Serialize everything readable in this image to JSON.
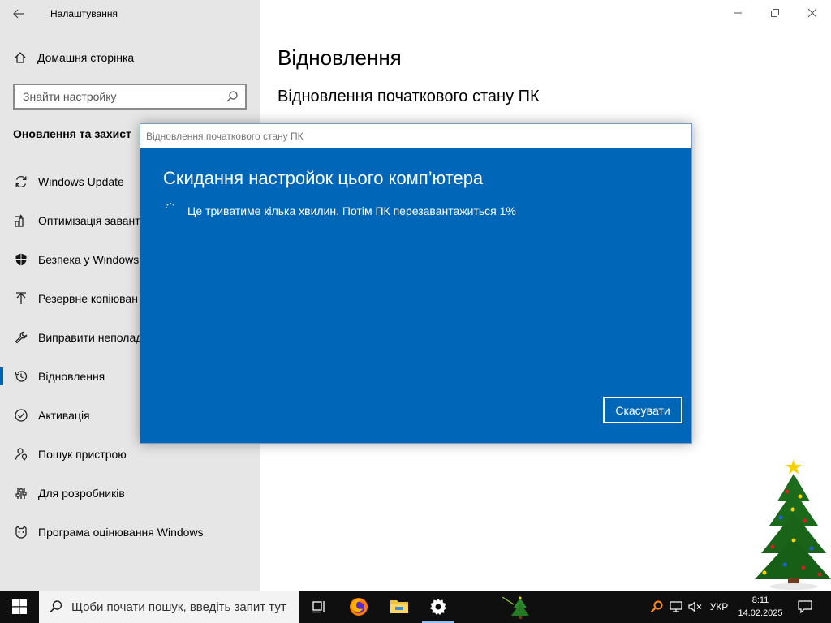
{
  "window": {
    "title": "Налаштування",
    "back_icon": "back-arrow-icon",
    "minimize_icon": "minimize-icon",
    "maximize_icon": "restore-icon",
    "close_icon": "close-icon"
  },
  "sidebar": {
    "home_label": "Домашня сторінка",
    "search_placeholder": "Знайти настройку",
    "section_title": "Оновлення та захист",
    "items": [
      {
        "label": "Windows Update",
        "icon": "sync-icon"
      },
      {
        "label": "Оптимізація завант",
        "icon": "delivery-optimization-icon"
      },
      {
        "label": "Безпека у Windows",
        "icon": "shield-icon"
      },
      {
        "label": "Резервне копіюван",
        "icon": "backup-arrow-icon"
      },
      {
        "label": "Виправити неполад",
        "icon": "wrench-icon"
      },
      {
        "label": "Відновлення",
        "icon": "history-icon",
        "active": true
      },
      {
        "label": "Активація",
        "icon": "check-circle-icon"
      },
      {
        "label": "Пошук пристрою",
        "icon": "person-pin-icon"
      },
      {
        "label": "Для розробників",
        "icon": "developer-sliders-icon"
      },
      {
        "label": "Програма оцінювання Windows",
        "icon": "insider-cat-icon"
      }
    ]
  },
  "main": {
    "title": "Відновлення",
    "subtitle": "Відновлення початкового стану ПК"
  },
  "dialog": {
    "window_title": "Відновлення початкового стану ПК",
    "heading": "Скидання настройок цього комп’ютера",
    "message": "Це триватиме кілька хвилин. Потім ПК перезавантажиться 1%",
    "progress_percent": 1,
    "cancel_label": "Скасувати"
  },
  "taskbar": {
    "search_placeholder": "Щоби почати пошук, введіть запит тут",
    "icons": [
      "windows-start-icon",
      "task-view-icon",
      "firefox-icon",
      "file-explorer-icon",
      "settings-gear-icon",
      "xmas-tree-app-icon"
    ],
    "tray": {
      "language": "УКР",
      "time": "8:11",
      "date": "14.02.2025"
    }
  },
  "colors": {
    "dialog_blue": "#0067b8",
    "accent": "#0063b1",
    "sidebar_bg": "#e6e6e6",
    "taskbar_bg": "#0f0f0f"
  }
}
